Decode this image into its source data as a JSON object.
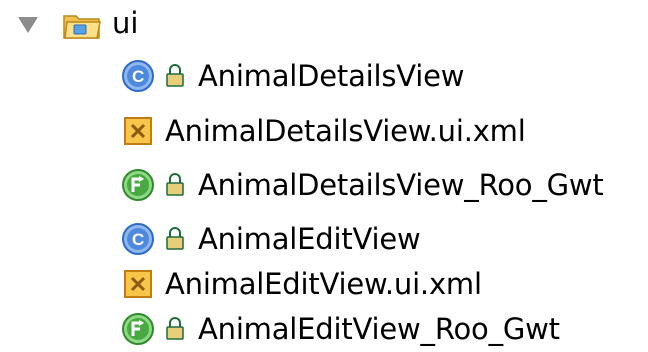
{
  "tree": {
    "root": {
      "label": "ui",
      "expanded": true,
      "icon": "package-folder-icon"
    },
    "children": [
      {
        "label": "AnimalDetailsView",
        "kind": "class",
        "icon": "class-icon",
        "locked": true
      },
      {
        "label": "AnimalDetailsView.ui.xml",
        "kind": "xml",
        "icon": "xml-file-icon",
        "locked": false
      },
      {
        "label": "AnimalDetailsView_Roo_Gwt",
        "kind": "aspect",
        "icon": "aspect-icon",
        "locked": true
      },
      {
        "label": "AnimalEditView",
        "kind": "class",
        "icon": "class-icon",
        "locked": true
      },
      {
        "label": "AnimalEditView.ui.xml",
        "kind": "xml",
        "icon": "xml-file-icon",
        "locked": false
      },
      {
        "label": "AnimalEditView_Roo_Gwt",
        "kind": "aspect",
        "icon": "aspect-icon",
        "locked": true
      }
    ]
  },
  "colors": {
    "class": "#3b79d6",
    "aspect": "#3fa53a",
    "xml": "#e8a21f",
    "folder": "#f4c95b"
  }
}
